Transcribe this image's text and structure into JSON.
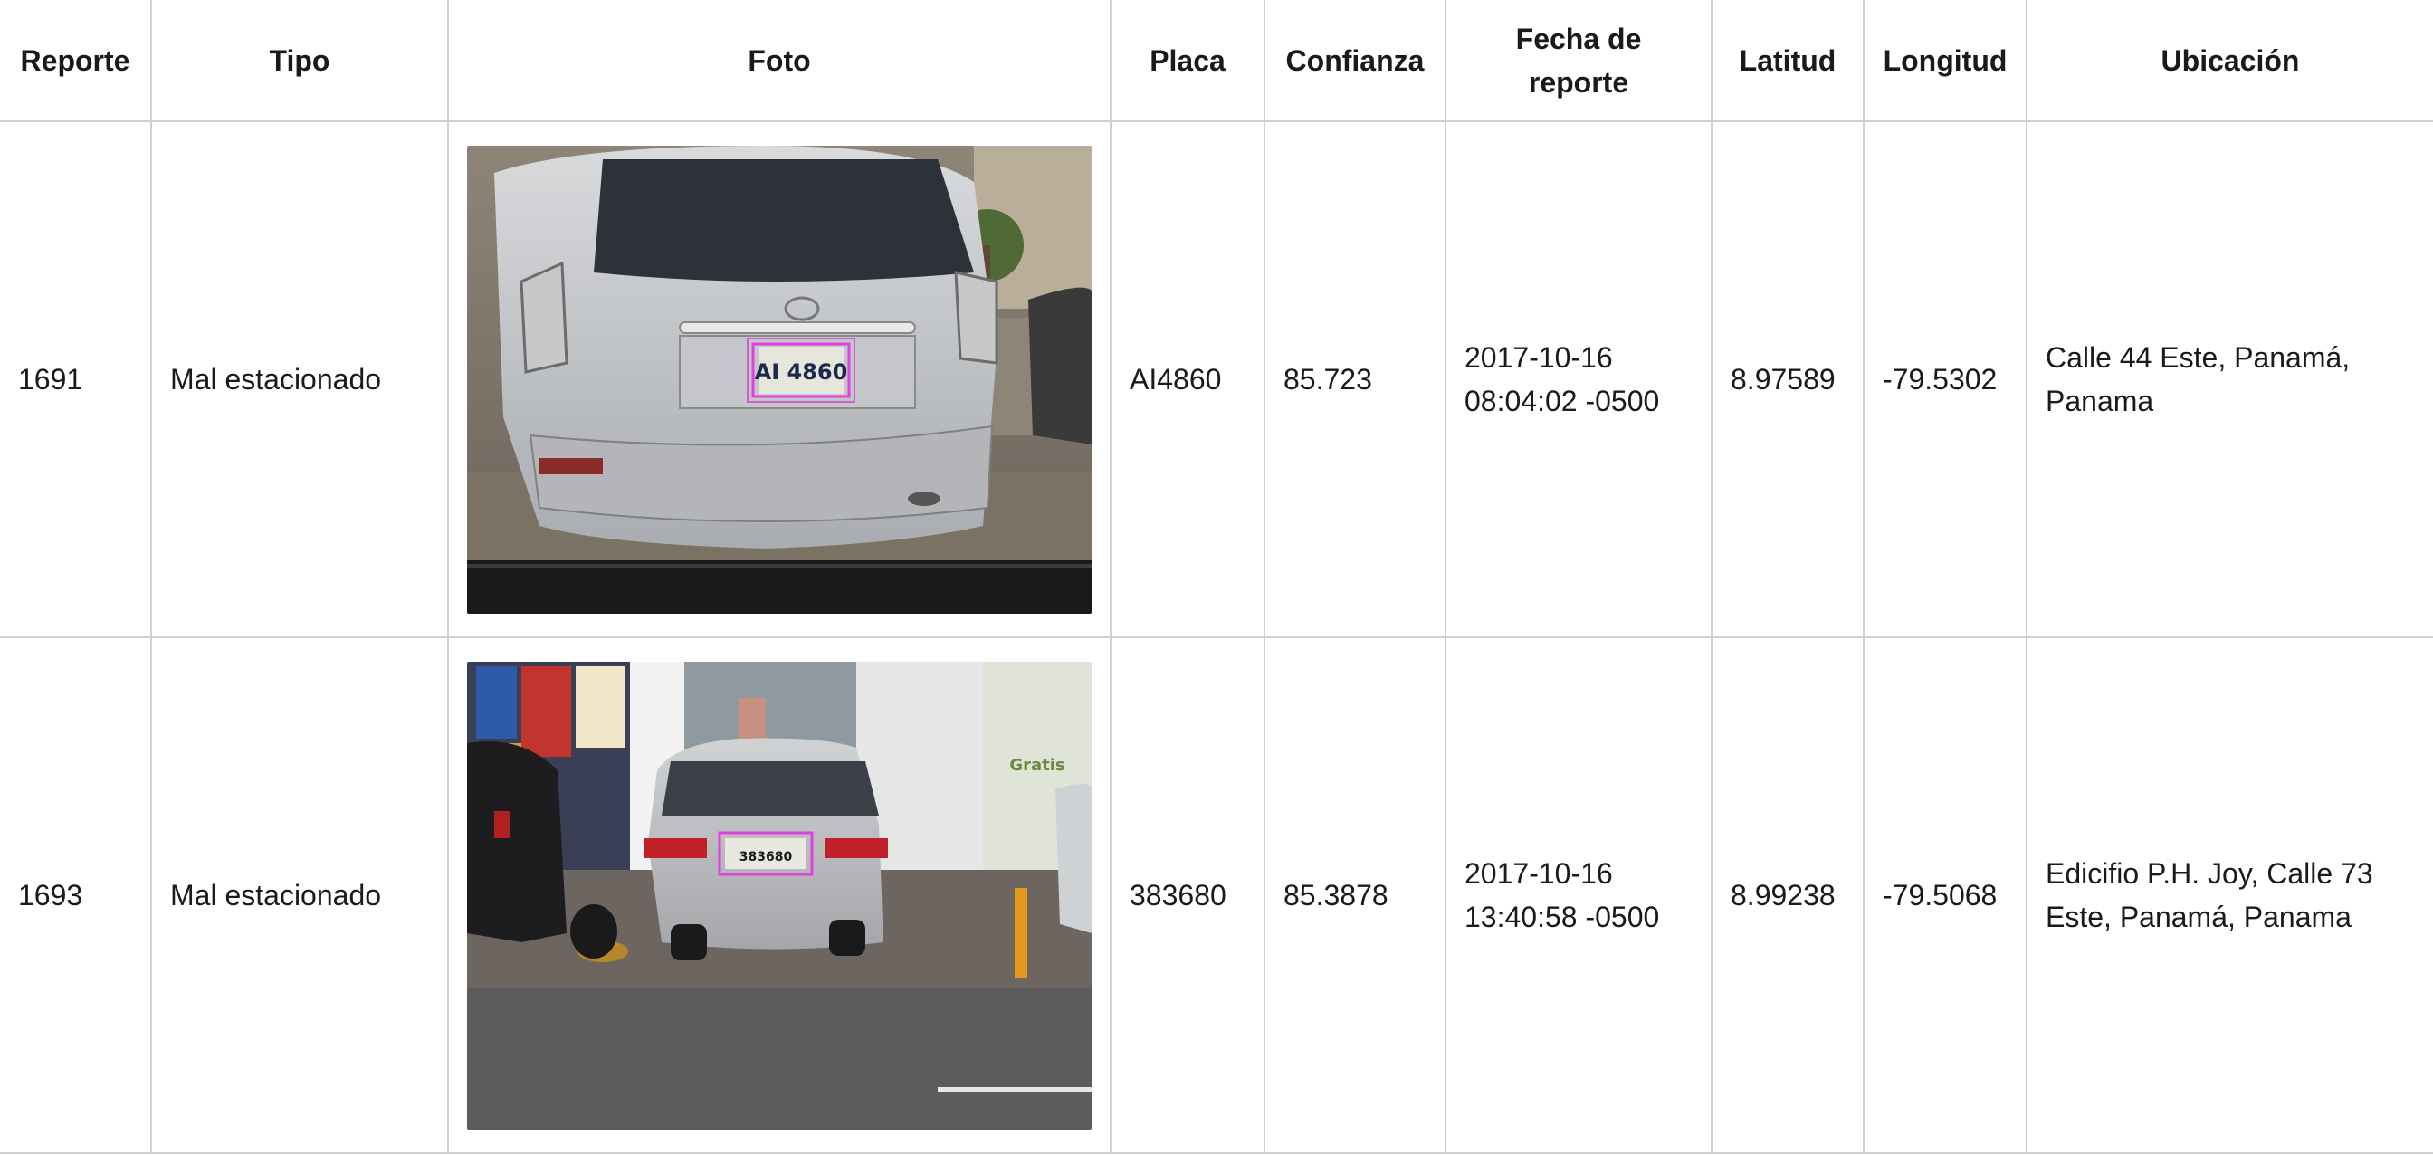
{
  "table": {
    "headers": {
      "reporte": "Reporte",
      "tipo": "Tipo",
      "foto": "Foto",
      "placa": "Placa",
      "confianza": "Confianza",
      "fecha_line1": "Fecha de",
      "fecha_line2": "reporte",
      "latitud": "Latitud",
      "longitud": "Longitud",
      "ubicacion": "Ubicación"
    },
    "rows": [
      {
        "reporte": "1691",
        "tipo": "Mal estacionado",
        "photo_plate_text": "AI 4860",
        "placa": "AI4860",
        "confianza": "85.723",
        "fecha_line1": "2017-10-16",
        "fecha_line2": "08:04:02 -0500",
        "latitud": "8.97589",
        "longitud": "-79.5302",
        "ubicacion": "Calle 44 Este, Panamá, Panama"
      },
      {
        "reporte": "1693",
        "tipo": "Mal estacionado",
        "photo_plate_text": "383680",
        "photo_sign_text": "Gratis",
        "placa": "383680",
        "confianza": "85.3878",
        "fecha_line1": "2017-10-16",
        "fecha_line2": "13:40:58 -0500",
        "latitud": "8.99238",
        "longitud": "-79.5068",
        "ubicacion": "Edicifio P.H. Joy, Calle 73 Este, Panamá, Panama"
      }
    ]
  },
  "colors": {
    "border": "#cfcfcf",
    "plate_highlight": "#e040e0",
    "text": "#1a1a1a"
  }
}
